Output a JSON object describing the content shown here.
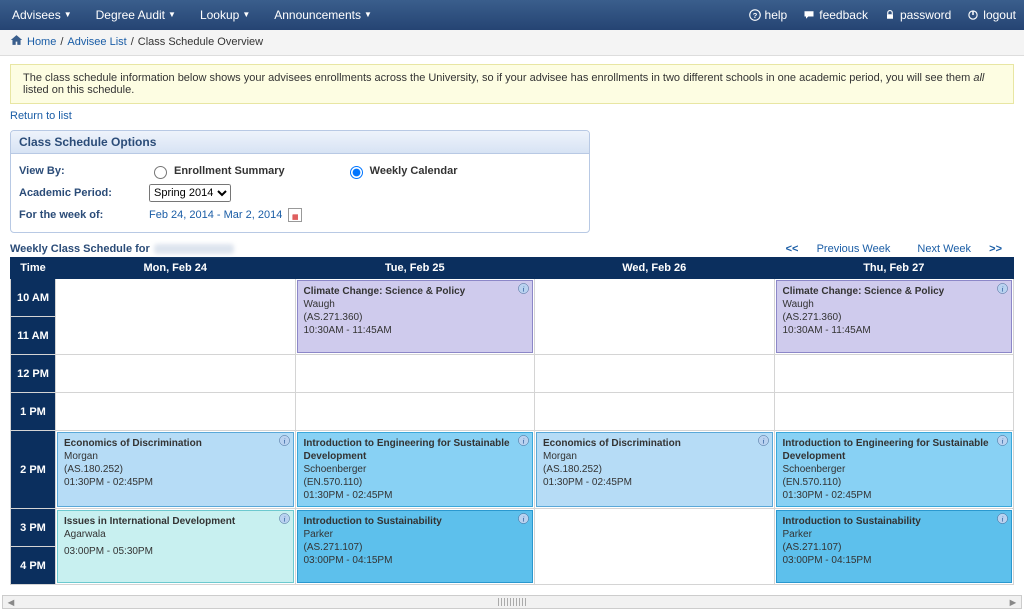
{
  "nav": {
    "items": [
      "Advisees",
      "Degree Audit",
      "Lookup",
      "Announcements"
    ],
    "help": "help",
    "feedback": "feedback",
    "password": "password",
    "logout": "logout"
  },
  "breadcrumb": {
    "home": "Home",
    "adviseeList": "Advisee List",
    "current": "Class Schedule Overview"
  },
  "banner": {
    "text_a": "The class schedule information below shows your advisees enrollments across the University, so if your advisee has enrollments in two different schools in one academic period, you will see them ",
    "text_ital": "all",
    "text_b": " listed on this schedule."
  },
  "returnLink": "Return to list",
  "options": {
    "panelTitle": "Class Schedule Options",
    "viewByLabel": "View By:",
    "enrollmentSummaryLabel": "Enrollment Summary",
    "weeklyCalendarLabel": "Weekly Calendar",
    "academicPeriodLabel": "Academic Period:",
    "academicPeriodValue": "Spring 2014",
    "weekOfLabel": "For the week of:",
    "weekRange": "Feb 24, 2014 - Mar 2, 2014"
  },
  "scheduleTitlePrefix": "Weekly Class Schedule for",
  "weekNav": {
    "prev": "Previous Week",
    "next": "Next Week"
  },
  "calendar": {
    "timeHeader": "Time",
    "days": [
      "Mon, Feb 24",
      "Tue, Feb 25",
      "Wed, Feb 26",
      "Thu, Feb 27"
    ],
    "hours": [
      "10 AM",
      "11 AM",
      "12 PM",
      "1 PM",
      "2 PM",
      "3 PM",
      "4 PM"
    ]
  },
  "events": {
    "climate": {
      "title": "Climate Change: Science & Policy",
      "instructor": "Waugh",
      "code": "(AS.271.360)",
      "time": "10:30AM - 11:45AM"
    },
    "econ": {
      "title": "Economics of Discrimination",
      "instructor": "Morgan",
      "code": "(AS.180.252)",
      "time": "01:30PM - 02:45PM"
    },
    "engSust": {
      "title": "Introduction to Engineering for Sustainable Development",
      "instructor": "Schoenberger",
      "code": "(EN.570.110)",
      "time": "01:30PM - 02:45PM"
    },
    "issues": {
      "title": "Issues in International Development",
      "instructor": "Agarwala",
      "code": "",
      "time": "03:00PM - 05:30PM"
    },
    "introSust": {
      "title": "Introduction to Sustainability",
      "instructor": "Parker",
      "code": "(AS.271.107)",
      "time": "03:00PM - 04:15PM"
    }
  }
}
